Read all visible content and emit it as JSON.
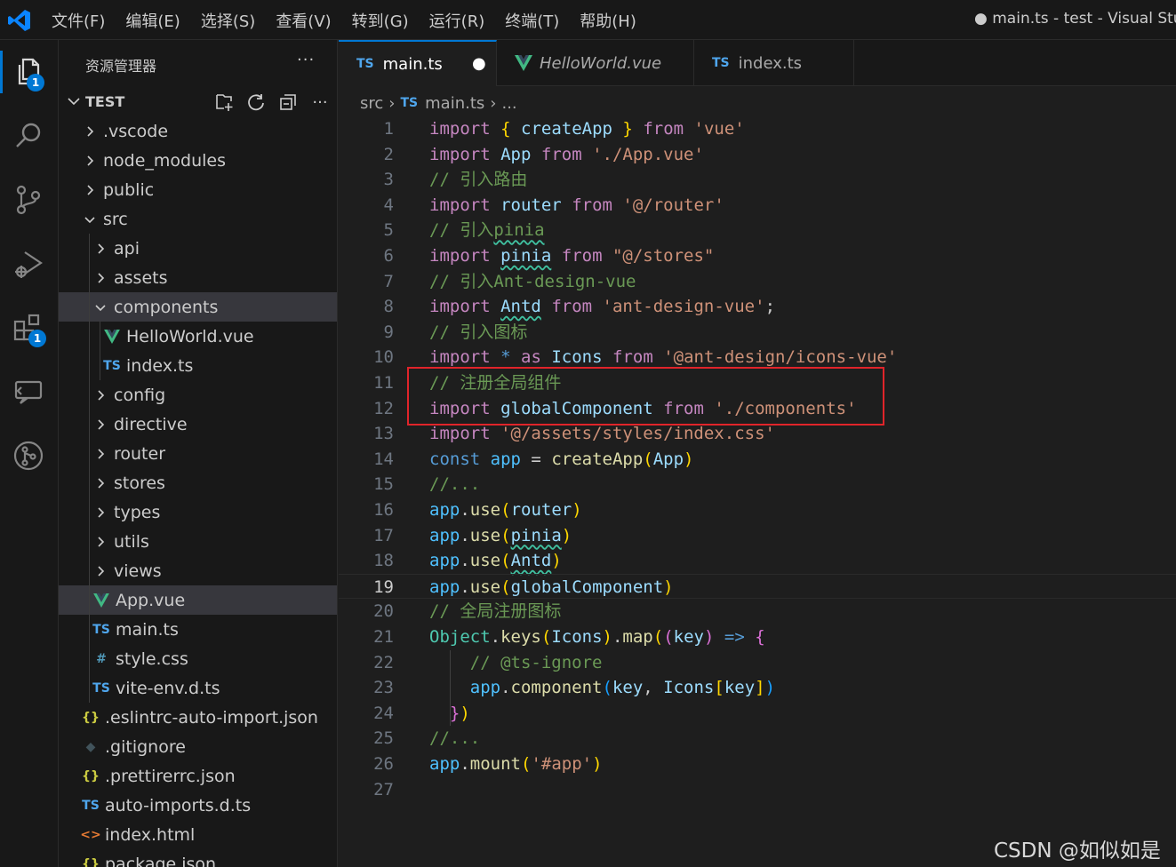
{
  "title_bar": {
    "menu": [
      "文件(F)",
      "编辑(E)",
      "选择(S)",
      "查看(V)",
      "转到(G)",
      "运行(R)",
      "终端(T)",
      "帮助(H)"
    ],
    "window_title": "● main.ts - test - Visual Studi"
  },
  "activity_bar": {
    "explorer_badge": "1",
    "extensions_badge": "1"
  },
  "sidebar": {
    "header": "资源管理器",
    "more": "···",
    "folder": "TEST",
    "tree": [
      {
        "label": ".vscode",
        "icon": "chevron-right"
      },
      {
        "label": "node_modules",
        "icon": "chevron-right"
      },
      {
        "label": "public",
        "icon": "chevron-right"
      },
      {
        "label": "src",
        "icon": "chevron-down"
      },
      {
        "label": "api",
        "icon": "chevron-right"
      },
      {
        "label": "assets",
        "icon": "chevron-right"
      },
      {
        "label": "components",
        "icon": "chevron-down"
      },
      {
        "label": "HelloWorld.vue",
        "icon": "vue-file"
      },
      {
        "label": "index.ts",
        "icon": "ts-file",
        "icon_text": "TS"
      },
      {
        "label": "config",
        "icon": "chevron-right"
      },
      {
        "label": "directive",
        "icon": "chevron-right"
      },
      {
        "label": "router",
        "icon": "chevron-right"
      },
      {
        "label": "stores",
        "icon": "chevron-right"
      },
      {
        "label": "types",
        "icon": "chevron-right"
      },
      {
        "label": "utils",
        "icon": "chevron-right"
      },
      {
        "label": "views",
        "icon": "chevron-right"
      },
      {
        "label": "App.vue",
        "icon": "vue-file"
      },
      {
        "label": "main.ts",
        "icon": "ts-file",
        "icon_text": "TS"
      },
      {
        "label": "style.css",
        "icon": "css-file",
        "icon_text": "#"
      },
      {
        "label": "vite-env.d.ts",
        "icon": "ts-file",
        "icon_text": "TS"
      },
      {
        "label": ".eslintrc-auto-import.json",
        "icon": "json-file",
        "icon_text": "{}"
      },
      {
        "label": ".gitignore",
        "icon": "git-file",
        "icon_text": "◆"
      },
      {
        "label": ".prettirerrc.json",
        "icon": "json-file",
        "icon_text": "{}"
      },
      {
        "label": "auto-imports.d.ts",
        "icon": "ts-file",
        "icon_text": "TS"
      },
      {
        "label": "index.html",
        "icon": "html-file",
        "icon_text": "<>"
      },
      {
        "label": "package.json",
        "icon": "json-file",
        "icon_text": "{}"
      }
    ]
  },
  "tabs": [
    {
      "icon_text": "TS",
      "label": "main.ts",
      "dirty": "●"
    },
    {
      "icon_text": "V",
      "label": "HelloWorld.vue"
    },
    {
      "icon_text": "TS",
      "label": "index.ts"
    }
  ],
  "breadcrumb": {
    "folder": "src",
    "icon_text": "TS",
    "file": "main.ts",
    "more": "..."
  },
  "editor": {
    "current_line": 19,
    "lines": [
      [
        [
          "kw",
          "import"
        ],
        [
          "pu",
          " "
        ],
        [
          "b1",
          "{"
        ],
        [
          "pu",
          " "
        ],
        [
          "vr",
          "createApp"
        ],
        [
          "pu",
          " "
        ],
        [
          "b1",
          "}"
        ],
        [
          "pu",
          " "
        ],
        [
          "kw",
          "from"
        ],
        [
          "pu",
          " "
        ],
        [
          "st",
          "'vue'"
        ]
      ],
      [
        [
          "kw",
          "import"
        ],
        [
          "pu",
          " "
        ],
        [
          "vr",
          "App"
        ],
        [
          "pu",
          " "
        ],
        [
          "kw",
          "from"
        ],
        [
          "pu",
          " "
        ],
        [
          "st",
          "'./App.vue'"
        ]
      ],
      [
        [
          "cm",
          "// 引入路由"
        ]
      ],
      [
        [
          "kw",
          "import"
        ],
        [
          "pu",
          " "
        ],
        [
          "vr",
          "router"
        ],
        [
          "pu",
          " "
        ],
        [
          "kw",
          "from"
        ],
        [
          "pu",
          " "
        ],
        [
          "st",
          "'@/router'"
        ]
      ],
      [
        [
          "cm",
          "// 引入"
        ],
        [
          "cmsq",
          "pinia"
        ]
      ],
      [
        [
          "kw",
          "import"
        ],
        [
          "pu",
          " "
        ],
        [
          "vrsq",
          "pinia"
        ],
        [
          "pu",
          " "
        ],
        [
          "kw",
          "from"
        ],
        [
          "pu",
          " "
        ],
        [
          "st",
          "\"@/stores\""
        ]
      ],
      [
        [
          "cm",
          "// 引入Ant-design-vue"
        ]
      ],
      [
        [
          "kw",
          "import"
        ],
        [
          "pu",
          " "
        ],
        [
          "vrsq",
          "Antd"
        ],
        [
          "pu",
          " "
        ],
        [
          "kw",
          "from"
        ],
        [
          "pu",
          " "
        ],
        [
          "st",
          "'ant-design-vue'"
        ],
        [
          "pu",
          ";"
        ]
      ],
      [
        [
          "cm",
          "// 引入图标"
        ]
      ],
      [
        [
          "kw",
          "import"
        ],
        [
          "pu",
          " "
        ],
        [
          "ky",
          "*"
        ],
        [
          "pu",
          " "
        ],
        [
          "kw",
          "as"
        ],
        [
          "pu",
          " "
        ],
        [
          "vr",
          "Icons"
        ],
        [
          "pu",
          " "
        ],
        [
          "kw",
          "from"
        ],
        [
          "pu",
          " "
        ],
        [
          "st",
          "'@ant-design/icons-vue'"
        ]
      ],
      [
        [
          "cm",
          "// 注册全局组件"
        ]
      ],
      [
        [
          "kw",
          "import"
        ],
        [
          "pu",
          " "
        ],
        [
          "vr",
          "globalComponent"
        ],
        [
          "pu",
          " "
        ],
        [
          "kw",
          "from"
        ],
        [
          "pu",
          " "
        ],
        [
          "st",
          "'./components'"
        ]
      ],
      [
        [
          "kw",
          "import"
        ],
        [
          "pu",
          " "
        ],
        [
          "st",
          "'@/assets/styles/index.css'"
        ]
      ],
      [
        [
          "ky",
          "const"
        ],
        [
          "pu",
          " "
        ],
        [
          "bk",
          "app"
        ],
        [
          "pu",
          " = "
        ],
        [
          "fn",
          "createApp"
        ],
        [
          "b1",
          "("
        ],
        [
          "vr",
          "App"
        ],
        [
          "b1",
          ")"
        ]
      ],
      [
        [
          "cm",
          "//..."
        ]
      ],
      [
        [
          "bk",
          "app"
        ],
        [
          "pu",
          "."
        ],
        [
          "fn",
          "use"
        ],
        [
          "b1",
          "("
        ],
        [
          "vr",
          "router"
        ],
        [
          "b1",
          ")"
        ]
      ],
      [
        [
          "bk",
          "app"
        ],
        [
          "pu",
          "."
        ],
        [
          "fn",
          "use"
        ],
        [
          "b1",
          "("
        ],
        [
          "vrsq",
          "pinia"
        ],
        [
          "b1",
          ")"
        ]
      ],
      [
        [
          "bk",
          "app"
        ],
        [
          "pu",
          "."
        ],
        [
          "fn",
          "use"
        ],
        [
          "b1",
          "("
        ],
        [
          "vrsq",
          "Antd"
        ],
        [
          "b1",
          ")"
        ]
      ],
      [
        [
          "bk",
          "app"
        ],
        [
          "pu",
          "."
        ],
        [
          "fn",
          "use"
        ],
        [
          "b1",
          "("
        ],
        [
          "vr",
          "globalComponent"
        ],
        [
          "b1",
          ")"
        ]
      ],
      [
        [
          "cm",
          "// 全局注册图标"
        ]
      ],
      [
        [
          "cl",
          "Object"
        ],
        [
          "pu",
          "."
        ],
        [
          "fn",
          "keys"
        ],
        [
          "b1",
          "("
        ],
        [
          "vr",
          "Icons"
        ],
        [
          "b1",
          ")"
        ],
        [
          "pu",
          "."
        ],
        [
          "fn",
          "map"
        ],
        [
          "b1",
          "("
        ],
        [
          "b2",
          "("
        ],
        [
          "vr",
          "key"
        ],
        [
          "b2",
          ")"
        ],
        [
          "pu",
          " "
        ],
        [
          "ky",
          "=>"
        ],
        [
          "pu",
          " "
        ],
        [
          "b2",
          "{"
        ]
      ],
      [
        [
          "pu",
          "    "
        ],
        [
          "cm",
          "// @ts-ignore"
        ]
      ],
      [
        [
          "pu",
          "    "
        ],
        [
          "bk",
          "app"
        ],
        [
          "pu",
          "."
        ],
        [
          "fn",
          "component"
        ],
        [
          "b3",
          "("
        ],
        [
          "vr",
          "key"
        ],
        [
          "pu",
          ", "
        ],
        [
          "vr",
          "Icons"
        ],
        [
          "b1",
          "["
        ],
        [
          "vr",
          "key"
        ],
        [
          "b1",
          "]"
        ],
        [
          "b3",
          ")"
        ]
      ],
      [
        [
          "pu",
          "  "
        ],
        [
          "b2",
          "}"
        ],
        [
          "b1",
          ")"
        ]
      ],
      [
        [
          "cm",
          "//..."
        ]
      ],
      [
        [
          "bk",
          "app"
        ],
        [
          "pu",
          "."
        ],
        [
          "fn",
          "mount"
        ],
        [
          "b1",
          "("
        ],
        [
          "st",
          "'#app'"
        ],
        [
          "b1",
          ")"
        ]
      ],
      []
    ]
  },
  "watermark": "CSDN @如似如是"
}
